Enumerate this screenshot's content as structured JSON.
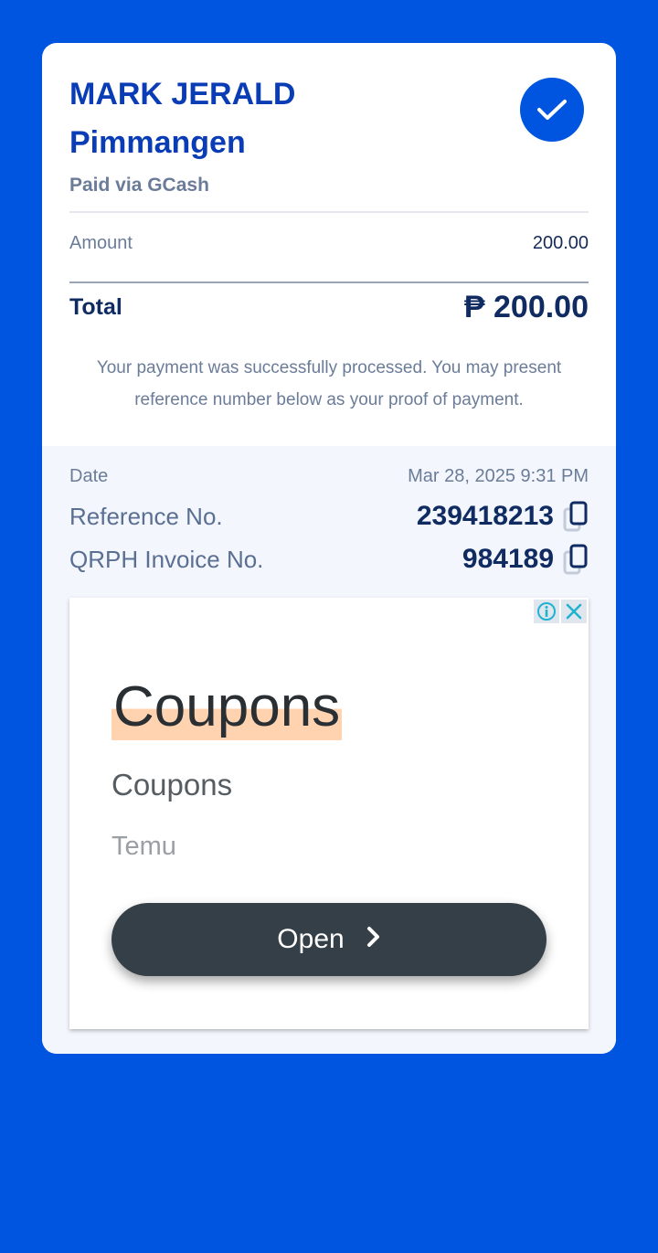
{
  "receipt": {
    "name_line1": "MARK JERALD",
    "name_line2": "Pimmangen",
    "paid_via": "Paid via GCash",
    "amount_label": "Amount",
    "amount_value": "200.00",
    "total_label": "Total",
    "total_value": "₱ 200.00",
    "message": "Your payment was successfully processed. You may present reference number below as your proof of payment."
  },
  "details": {
    "date_label": "Date",
    "date_value": "Mar 28, 2025 9:31 PM",
    "reference_label": "Reference No.",
    "reference_value": "239418213",
    "invoice_label": "QRPH Invoice No.",
    "invoice_value": "984189"
  },
  "ad": {
    "title": "Coupons",
    "subtitle": "Coupons",
    "brand": "Temu",
    "button_label": "Open"
  },
  "colors": {
    "background": "#0055e0",
    "primary_text": "#0a3db5",
    "muted_text": "#6b7c99",
    "details_bg": "#f3f7fd",
    "ad_button": "#343f47"
  }
}
